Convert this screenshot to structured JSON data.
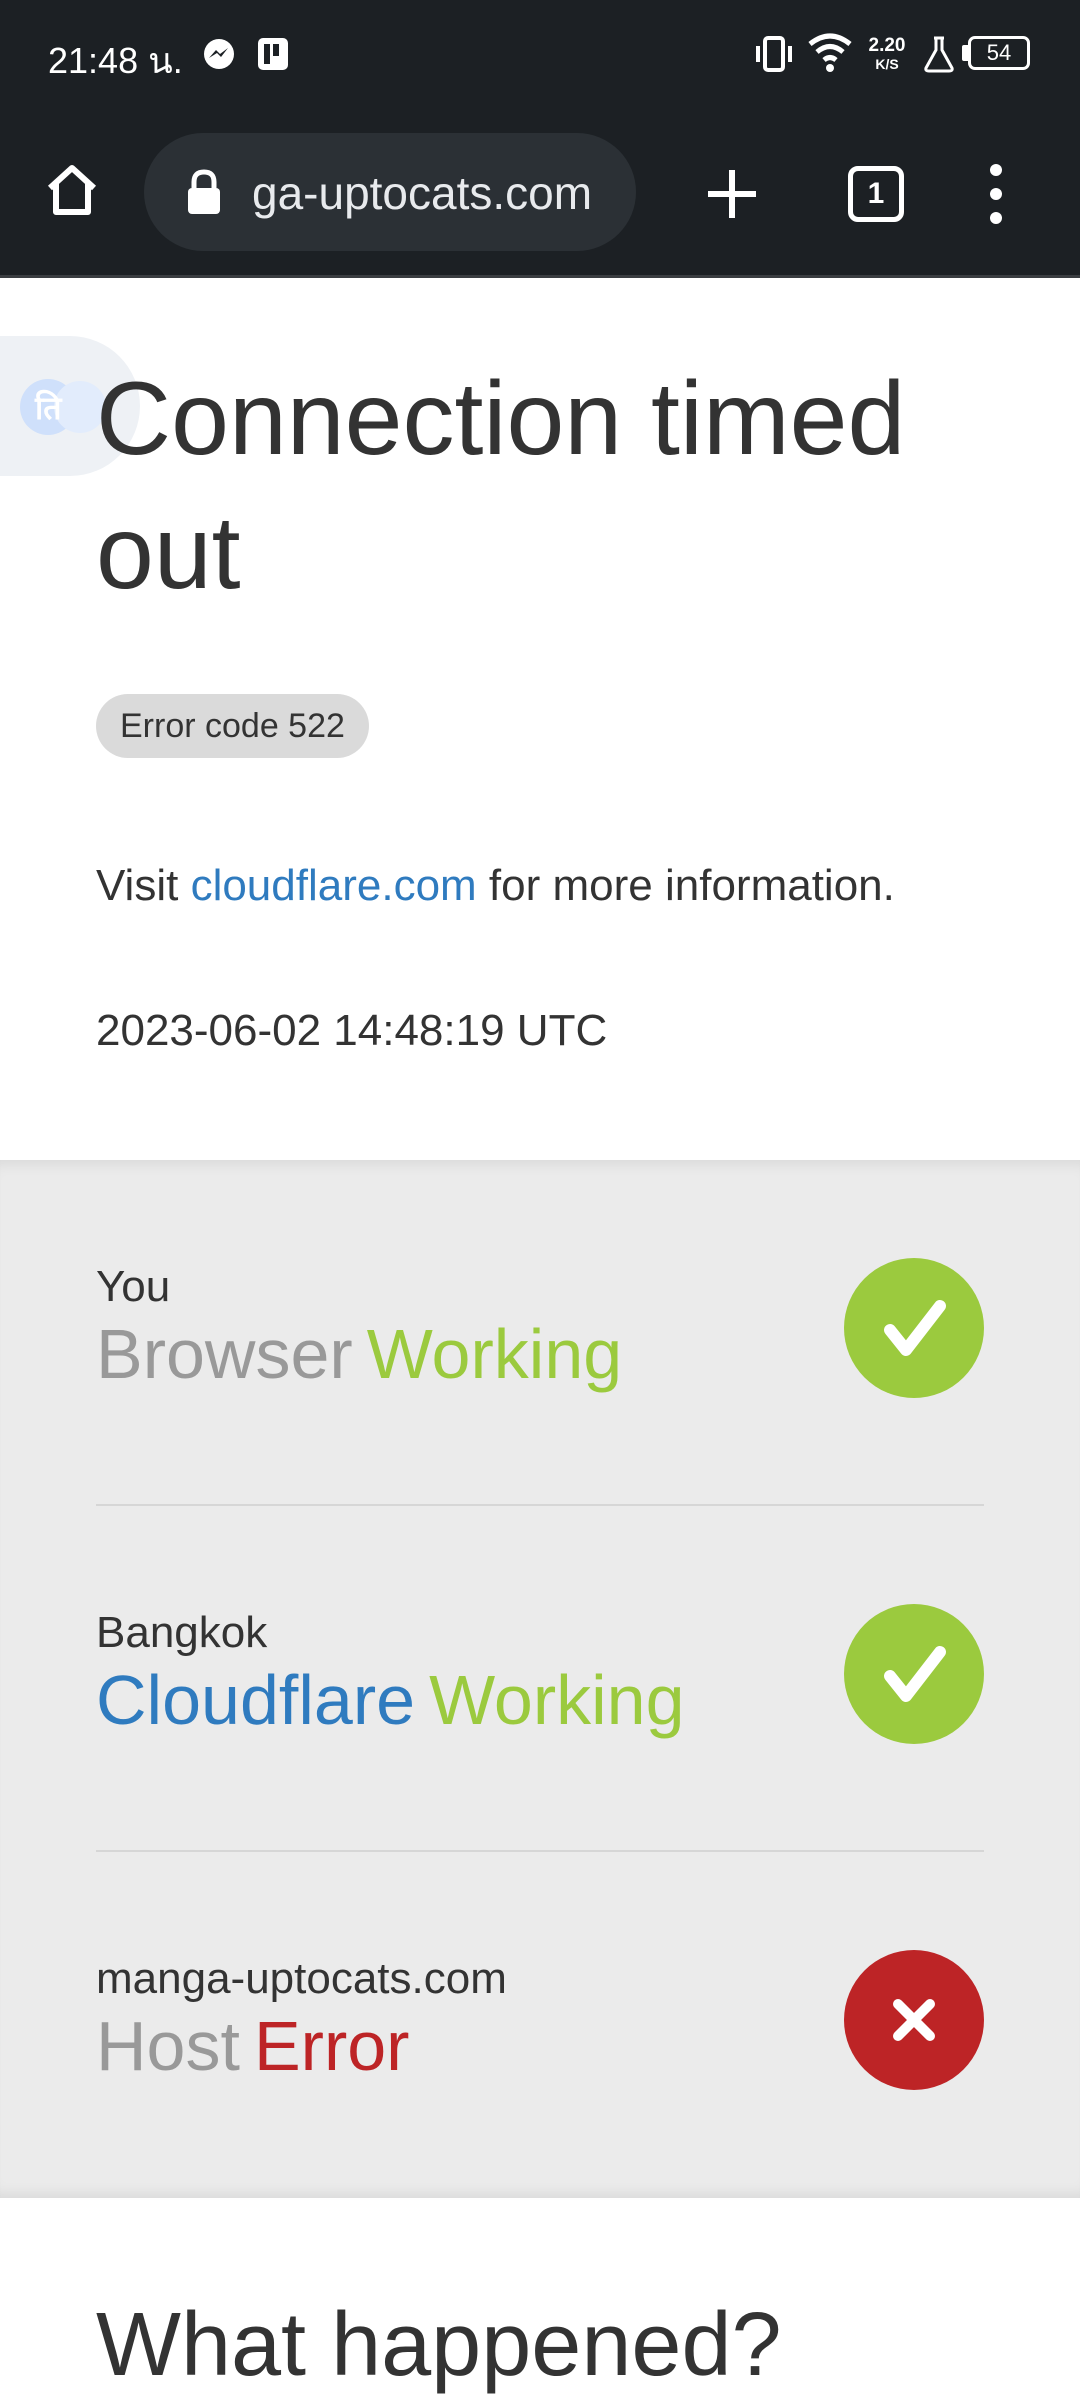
{
  "status_bar": {
    "time": "21:48 น.",
    "net_speed_value": "2.20",
    "net_speed_unit": "K/S",
    "battery": "54"
  },
  "toolbar": {
    "url": "ga-uptocats.com",
    "tab_count": "1"
  },
  "page": {
    "title": "Connection timed out",
    "error_code": "Error code 522",
    "info_prefix": "Visit ",
    "info_link": "cloudflare.com",
    "info_suffix": " for more information.",
    "timestamp": "2023-06-02 14:48:19 UTC",
    "what_happened": "What happened?"
  },
  "status_rows": [
    {
      "location": "You",
      "name": "Browser",
      "status": "Working",
      "state": "ok"
    },
    {
      "location": "Bangkok",
      "name": "Cloudflare",
      "status": "Working",
      "state": "ok"
    },
    {
      "location": "manga-uptocats.com",
      "name": "Host",
      "status": "Error",
      "state": "error"
    }
  ],
  "colors": {
    "status_bar_bg": "#1c2024",
    "ok_green": "#9bca3e",
    "error_red": "#bd2426",
    "link_blue": "#2f7bbf"
  },
  "icons": [
    "home-icon",
    "lock-icon",
    "new-tab-icon",
    "tab-switcher-icon",
    "more-menu-icon",
    "translate-icon",
    "check-icon",
    "close-icon"
  ]
}
